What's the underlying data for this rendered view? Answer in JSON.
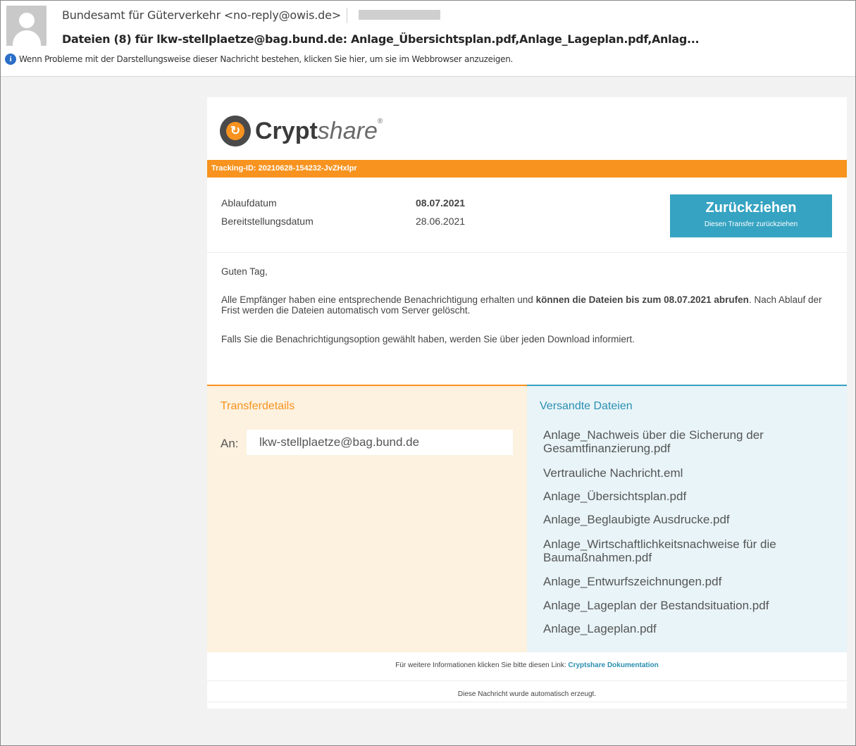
{
  "email": {
    "sender": "Bundesamt für Güterverkehr <no-reply@owis.de>",
    "subject": "Dateien (8) für lkw-stellplaetze@bag.bund.de: Anlage_Übersichtsplan.pdf,Anlage_Lageplan.pdf,Anlag...",
    "info_text": "Wenn Probleme mit der Darstellungsweise dieser Nachricht bestehen, klicken Sie hier, um sie im Webbrowser anzuzeigen.",
    "info_icon": "i"
  },
  "logo": {
    "mark_glyph": "↻",
    "word_bold": "Crypt",
    "word_italic": "share",
    "reg": "®"
  },
  "tracking": {
    "label": "Tracking-ID: 20210628-154232-JvZHxlpr"
  },
  "dates": {
    "expiry_label": "Ablaufdatum",
    "expiry_value": "08.07.2021",
    "provision_label": "Bereitstellungsdatum",
    "provision_value": "28.06.2021"
  },
  "withdraw_button": {
    "title": "Zurückziehen",
    "subtitle": "Diesen Transfer zurückziehen"
  },
  "message": {
    "greeting": "Guten Tag,",
    "p1_start": "Alle Empfänger haben eine entsprechende Benachrichtigung erhalten und ",
    "p1_bold": "können die Dateien bis zum 08.07.2021 abrufen",
    "p1_end": ". Nach Ablauf der Frist werden die Dateien automatisch vom Server gelöscht.",
    "p2": "Falls Sie die Benachrichtigungsoption gewählt haben, werden Sie über jeden Download informiert."
  },
  "transfer": {
    "title": "Transferdetails",
    "to_label": "An:",
    "to_value": "lkw-stellplaetze@bag.bund.de"
  },
  "files": {
    "title": "Versandte Dateien",
    "items": [
      "Anlage_Nachweis über die Sicherung der Gesamtfinanzierung.pdf",
      "Vertrauliche Nachricht.eml",
      "Anlage_Übersichtsplan.pdf",
      "Anlage_Beglaubigte Ausdrucke.pdf",
      "Anlage_Wirtschaftlichkeitsnachweise für die Baumaßnahmen.pdf",
      "Anlage_Entwurfszeichnungen.pdf",
      "Anlage_Lageplan der Bestandsituation.pdf",
      "Anlage_Lageplan.pdf"
    ]
  },
  "footer": {
    "info_text": "Für weitere Informationen klicken Sie bitte diesen Link: ",
    "link": "Cryptshare Dokumentation",
    "auto_text": "Diese Nachricht wurde automatisch erzeugt."
  },
  "colors": {
    "orange": "#f7931e",
    "teal": "#36a3c2",
    "link": "#2a8fb0"
  }
}
